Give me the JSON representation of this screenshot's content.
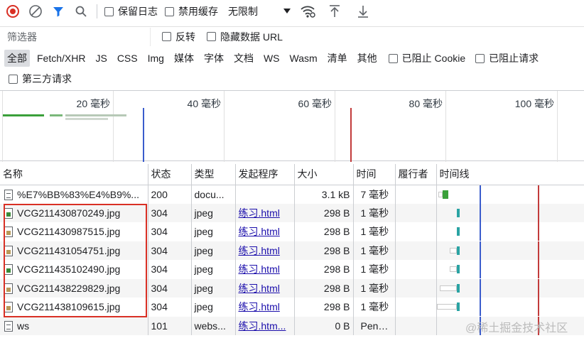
{
  "toolbar": {
    "preserve_log": "保留日志",
    "disable_cache": "禁用缓存",
    "throttle": "无限制"
  },
  "filter_bar": {
    "placeholder": "筛选器",
    "invert": "反转",
    "hide_data_urls": "隐藏数据 URL"
  },
  "type_filters": [
    "全部",
    "Fetch/XHR",
    "JS",
    "CSS",
    "Img",
    "媒体",
    "字体",
    "文档",
    "WS",
    "Wasm",
    "清单",
    "其他"
  ],
  "blocked_cookies": "已阻止 Cookie",
  "blocked_requests": "已阻止请求",
  "third_party": "第三方请求",
  "overview": {
    "ticks": [
      "20 毫秒",
      "40 毫秒",
      "60 毫秒",
      "80 毫秒",
      "100 毫秒"
    ]
  },
  "table": {
    "headers": [
      "名称",
      "状态",
      "类型",
      "发起程序",
      "大小",
      "时间",
      "履行者",
      "时间线"
    ],
    "rows": [
      {
        "name": "%E7%BB%83%E4%B9%...",
        "status": "200",
        "type": "docu...",
        "initiator": "",
        "size": "3.1 kB",
        "time": "7 毫秒",
        "icon": "doc"
      },
      {
        "name": "VCG211430870249.jpg",
        "status": "304",
        "type": "jpeg",
        "initiator": "练习.html",
        "size": "298 B",
        "time": "1 毫秒",
        "icon": "img"
      },
      {
        "name": "VCG211430987515.jpg",
        "status": "304",
        "type": "jpeg",
        "initiator": "练习.html",
        "size": "298 B",
        "time": "1 毫秒",
        "icon": "img2"
      },
      {
        "name": "VCG211431054751.jpg",
        "status": "304",
        "type": "jpeg",
        "initiator": "练习.html",
        "size": "298 B",
        "time": "1 毫秒",
        "icon": "img2"
      },
      {
        "name": "VCG211435102490.jpg",
        "status": "304",
        "type": "jpeg",
        "initiator": "练习.html",
        "size": "298 B",
        "time": "1 毫秒",
        "icon": "img"
      },
      {
        "name": "VCG211438229829.jpg",
        "status": "304",
        "type": "jpeg",
        "initiator": "练习.html",
        "size": "298 B",
        "time": "1 毫秒",
        "icon": "img2"
      },
      {
        "name": "VCG211438109615.jpg",
        "status": "304",
        "type": "jpeg",
        "initiator": "练习.html",
        "size": "298 B",
        "time": "1 毫秒",
        "icon": "img2"
      },
      {
        "name": "ws",
        "status": "101",
        "type": "webs...",
        "initiator": "练习.htm...",
        "size": "0 B",
        "time": "Pendi...",
        "icon": "doc"
      }
    ]
  },
  "watermark": "@稀土掘金技术社区",
  "colors": {
    "record": "#d93025",
    "filter_active": "#1a73e8",
    "dom_line": "#3a5ccc",
    "load_line": "#c23b3b"
  }
}
